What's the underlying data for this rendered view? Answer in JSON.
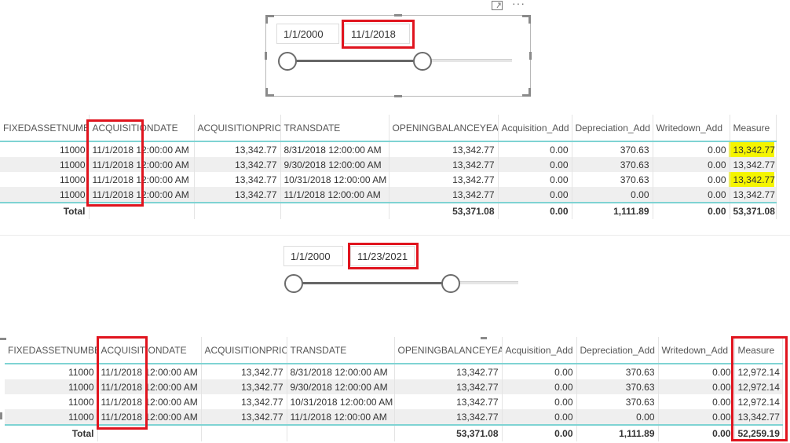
{
  "top_slicer": {
    "start_date": "1/1/2000",
    "end_date": "11/1/2018",
    "focus_icon": "expand-icon",
    "more_icon": "more-options-icon"
  },
  "bottom_slicer": {
    "start_date": "1/1/2000",
    "end_date": "11/23/2021"
  },
  "columns": [
    "FIXEDASSETNUMBER",
    "ACQUISITIONDATE",
    "ACQUISITIONPRICE",
    "TRANSDATE",
    "OPENINGBALANCEYEAR",
    "Acquisition_Add",
    "Depreciation_Add",
    "Writedown_Add",
    "Measure"
  ],
  "table1": {
    "rows": [
      [
        "11000",
        "11/1/2018 12:00:00 AM",
        "13,342.77",
        "8/31/2018 12:00:00 AM",
        "13,342.77",
        "0.00",
        "370.63",
        "0.00",
        "13,342.77"
      ],
      [
        "11000",
        "11/1/2018 12:00:00 AM",
        "13,342.77",
        "9/30/2018 12:00:00 AM",
        "13,342.77",
        "0.00",
        "370.63",
        "0.00",
        "13,342.77"
      ],
      [
        "11000",
        "11/1/2018 12:00:00 AM",
        "13,342.77",
        "10/31/2018 12:00:00 AM",
        "13,342.77",
        "0.00",
        "370.63",
        "0.00",
        "13,342.77"
      ],
      [
        "11000",
        "11/1/2018 12:00:00 AM",
        "13,342.77",
        "11/1/2018 12:00:00 AM",
        "13,342.77",
        "0.00",
        "0.00",
        "0.00",
        "13,342.77"
      ]
    ],
    "total": [
      "Total",
      "",
      "",
      "",
      "53,371.08",
      "0.00",
      "1,111.89",
      "0.00",
      "53,371.08"
    ]
  },
  "table2": {
    "rows": [
      [
        "11000",
        "11/1/2018 12:00:00 AM",
        "13,342.77",
        "8/31/2018 12:00:00 AM",
        "13,342.77",
        "0.00",
        "370.63",
        "0.00",
        "12,972.14"
      ],
      [
        "11000",
        "11/1/2018 12:00:00 AM",
        "13,342.77",
        "9/30/2018 12:00:00 AM",
        "13,342.77",
        "0.00",
        "370.63",
        "0.00",
        "12,972.14"
      ],
      [
        "11000",
        "11/1/2018 12:00:00 AM",
        "13,342.77",
        "10/31/2018 12:00:00 AM",
        "13,342.77",
        "0.00",
        "370.63",
        "0.00",
        "12,972.14"
      ],
      [
        "11000",
        "11/1/2018 12:00:00 AM",
        "13,342.77",
        "11/1/2018 12:00:00 AM",
        "13,342.77",
        "0.00",
        "0.00",
        "0.00",
        "13,342.77"
      ]
    ],
    "total": [
      "Total",
      "",
      "",
      "",
      "53,371.08",
      "0.00",
      "1,111.89",
      "0.00",
      "52,259.19"
    ]
  },
  "colors": {
    "annotation_red": "#e0141e",
    "highlight_yellow": "#f5f500",
    "table_accent": "#7fd3d3"
  }
}
